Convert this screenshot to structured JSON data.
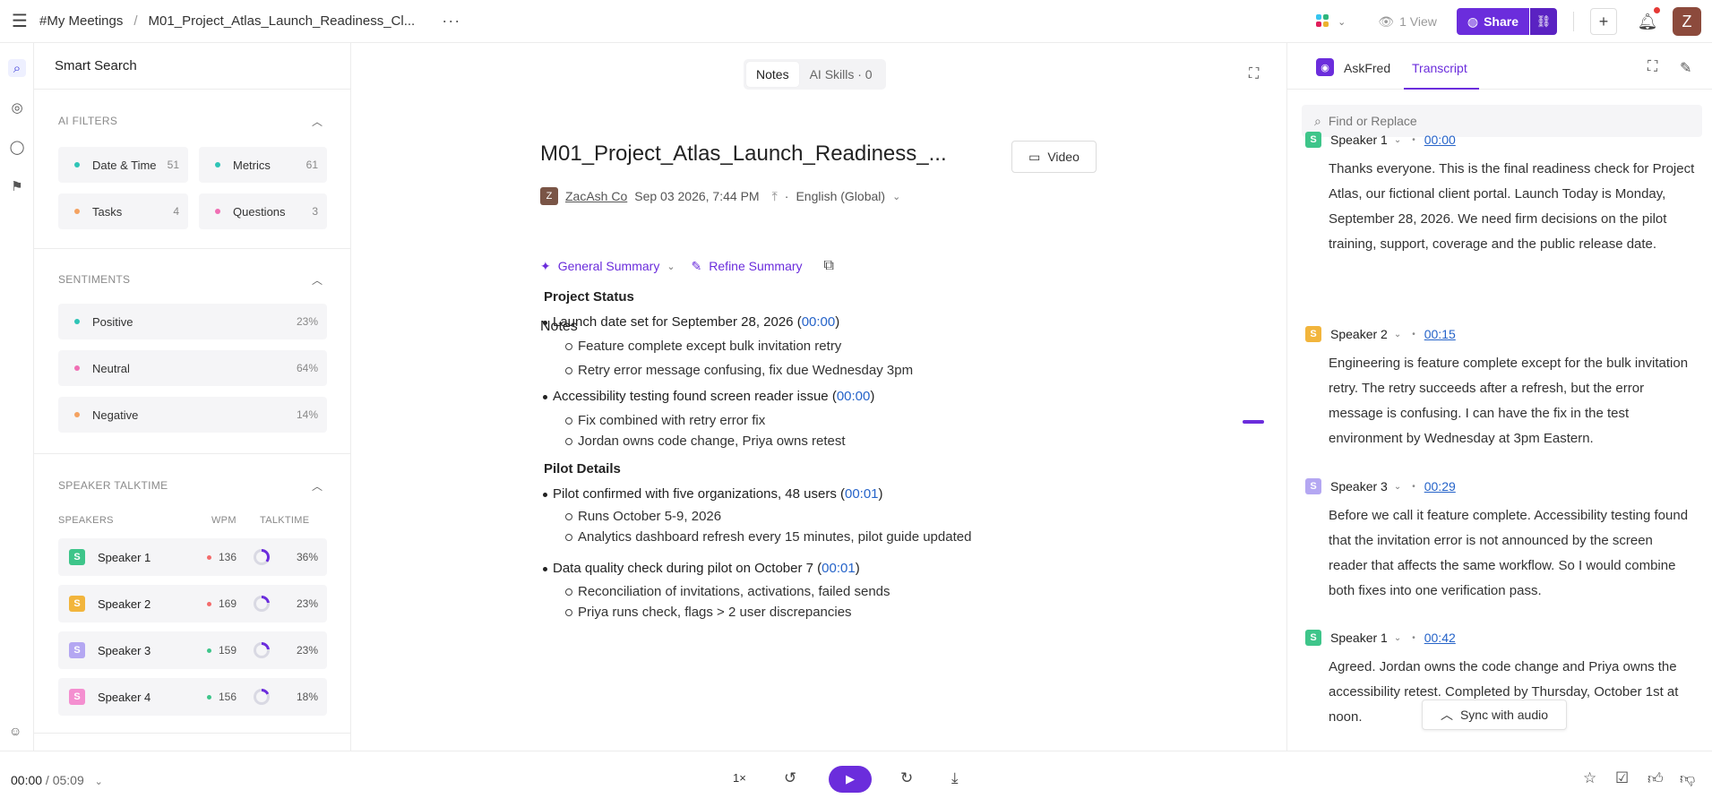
{
  "breadcrumb": {
    "workspace": "#My Meetings",
    "separator": "/",
    "meeting": "M01_Project_Atlas_Launch_Readiness_Cl...",
    "more": "···"
  },
  "topbar": {
    "views": "1 View",
    "share": "Share",
    "avatar": "Z"
  },
  "filters": {
    "search_label": "Smart Search",
    "ai_filters_title": "AI FILTERS",
    "ai_filters": [
      {
        "label": "Date & Time",
        "count": "51",
        "color": "#2ec4b6"
      },
      {
        "label": "Metrics",
        "count": "61",
        "color": "#2ec4b6"
      },
      {
        "label": "Tasks",
        "count": "4",
        "color": "#f4a261"
      },
      {
        "label": "Questions",
        "count": "3",
        "color": "#f06fb4"
      }
    ],
    "sentiments_title": "SENTIMENTS",
    "sentiments": [
      {
        "label": "Positive",
        "value": "23%",
        "color": "#2ec4b6"
      },
      {
        "label": "Neutral",
        "value": "64%",
        "color": "#f06fb4"
      },
      {
        "label": "Negative",
        "value": "14%",
        "color": "#f4a261"
      }
    ],
    "talktime_title": "SPEAKER TALKTIME",
    "talktime_headers": {
      "speakers": "SPEAKERS",
      "wpm": "WPM",
      "talktime": "TALKTIME"
    },
    "speakers": [
      {
        "initial": "S",
        "name": "Speaker 1",
        "wpm": "136",
        "talktime": "36%",
        "talktime_fraction": 0.36,
        "badge_color": "#3ec58a",
        "wpm_color": "#f36b6b"
      },
      {
        "initial": "S",
        "name": "Speaker 2",
        "wpm": "169",
        "talktime": "23%",
        "talktime_fraction": 0.23,
        "badge_color": "#f2b53c",
        "wpm_color": "#f36b6b"
      },
      {
        "initial": "S",
        "name": "Speaker 3",
        "wpm": "159",
        "talktime": "23%",
        "talktime_fraction": 0.23,
        "badge_color": "#b4a7f2",
        "wpm_color": "#3ec58a"
      },
      {
        "initial": "S",
        "name": "Speaker 4",
        "wpm": "156",
        "talktime": "18%",
        "talktime_fraction": 0.18,
        "badge_color": "#f48fd0",
        "wpm_color": "#3ec58a"
      }
    ]
  },
  "center": {
    "tab_notes": "Notes",
    "tab_ai": "AI Skills · 0",
    "title": "M01_Project_Atlas_Launch_Readiness_...",
    "video": "Video",
    "meta_initial": "Z",
    "company": "ZacAsh Co",
    "date": "Sep 03 2026, 7:44 PM",
    "meta_sep": "·",
    "language": "English (Global)",
    "general_summary": "General Summary",
    "refine_summary": "Refine Summary",
    "notes_heading": "Notes",
    "sections": [
      {
        "heading": "Project Status"
      },
      {
        "heading": "Pilot Details"
      }
    ],
    "bullets": [
      {
        "text": "Launch date set for September 28, 2026 (",
        "ts": "00:00",
        "close": ")"
      },
      {
        "text": "Accessibility testing found screen reader issue (",
        "ts": "00:00",
        "close": ")"
      },
      {
        "text": "Pilot confirmed with five organizations, 48 users (",
        "ts": "00:01",
        "close": ")"
      },
      {
        "text": "Data quality check during pilot on October 7 (",
        "ts": "00:01",
        "close": ")"
      }
    ],
    "subbullets": [
      "Feature complete except bulk invitation retry",
      "Retry error message confusing, fix due Wednesday 3pm",
      "Fix combined with retry error fix",
      "Jordan owns code change, Priya owns retest",
      "Runs October 5-9, 2026",
      "Analytics dashboard refresh every 15 minutes, pilot guide updated",
      "Reconciliation of invitations, activations, failed sends",
      "Priya runs check, flags > 2 user discrepancies"
    ]
  },
  "transcript": {
    "tab_askfred": "AskFred",
    "tab_transcript": "Transcript",
    "find_placeholder": "Find or Replace",
    "sync": "Sync with audio",
    "turns": [
      {
        "initial": "S",
        "speaker": "Speaker 1",
        "time": "00:00",
        "color": "#3ec58a",
        "text": "Thanks everyone. This is the final readiness check for Project Atlas, our fictional client portal. Launch Today is Monday, September 28, 2026. We need firm decisions on the pilot training, support, coverage and the public release date."
      },
      {
        "initial": "S",
        "speaker": "Speaker 2",
        "time": "00:15",
        "color": "#f2b53c",
        "text": "Engineering is feature complete except for the bulk invitation retry. The retry succeeds after a refresh, but the error message is confusing. I can have the fix in the test environment by Wednesday at 3pm Eastern."
      },
      {
        "initial": "S",
        "speaker": "Speaker 3",
        "time": "00:29",
        "color": "#b4a7f2",
        "text": "Before we call it feature complete. Accessibility testing found that the invitation error is not announced by the screen reader that affects the same workflow. So I would combine both fixes into one verification pass."
      },
      {
        "initial": "S",
        "speaker": "Speaker 1",
        "time": "00:42",
        "color": "#3ec58a",
        "text": "Agreed. Jordan owns the code change and Priya owns the accessibility retest. Completed by Thursday, October 1st at noon."
      }
    ]
  },
  "player": {
    "current": "00:00",
    "separator": " / ",
    "total": "05:09",
    "speed": "1×"
  },
  "colors": {
    "accent": "#6b2ddc",
    "link": "#2563c9"
  }
}
